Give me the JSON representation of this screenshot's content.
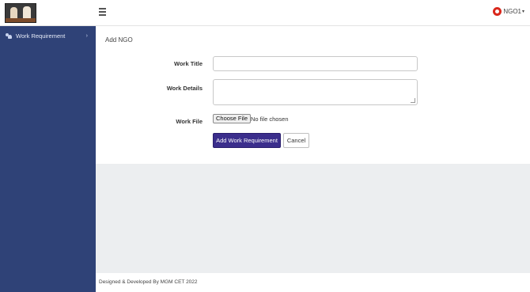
{
  "header": {
    "menu_icon": "hamburger-icon",
    "user": {
      "icon": "user-circle-icon",
      "name": "NGO1",
      "caret": "▾"
    }
  },
  "sidebar": {
    "items": [
      {
        "label": "Work Requirement",
        "icon": "users-icon",
        "chevron": "›"
      }
    ]
  },
  "main": {
    "title": "Add NGO",
    "form": {
      "work_title_label": "Work Title",
      "work_title_value": "",
      "work_details_label": "Work Details",
      "work_details_value": "",
      "work_file_label": "Work File",
      "file_button_label": "Choose File",
      "file_status": "No file chosen",
      "submit_label": "Add Work Requirement",
      "cancel_label": "Cancel"
    }
  },
  "footer": {
    "text": "Designed & Developed By MGM CET 2022"
  },
  "colors": {
    "sidebar_bg": "#2f4277",
    "primary_button": "#3b2e8c",
    "content_bg": "#eceef0",
    "user_icon": "#d9281c"
  }
}
